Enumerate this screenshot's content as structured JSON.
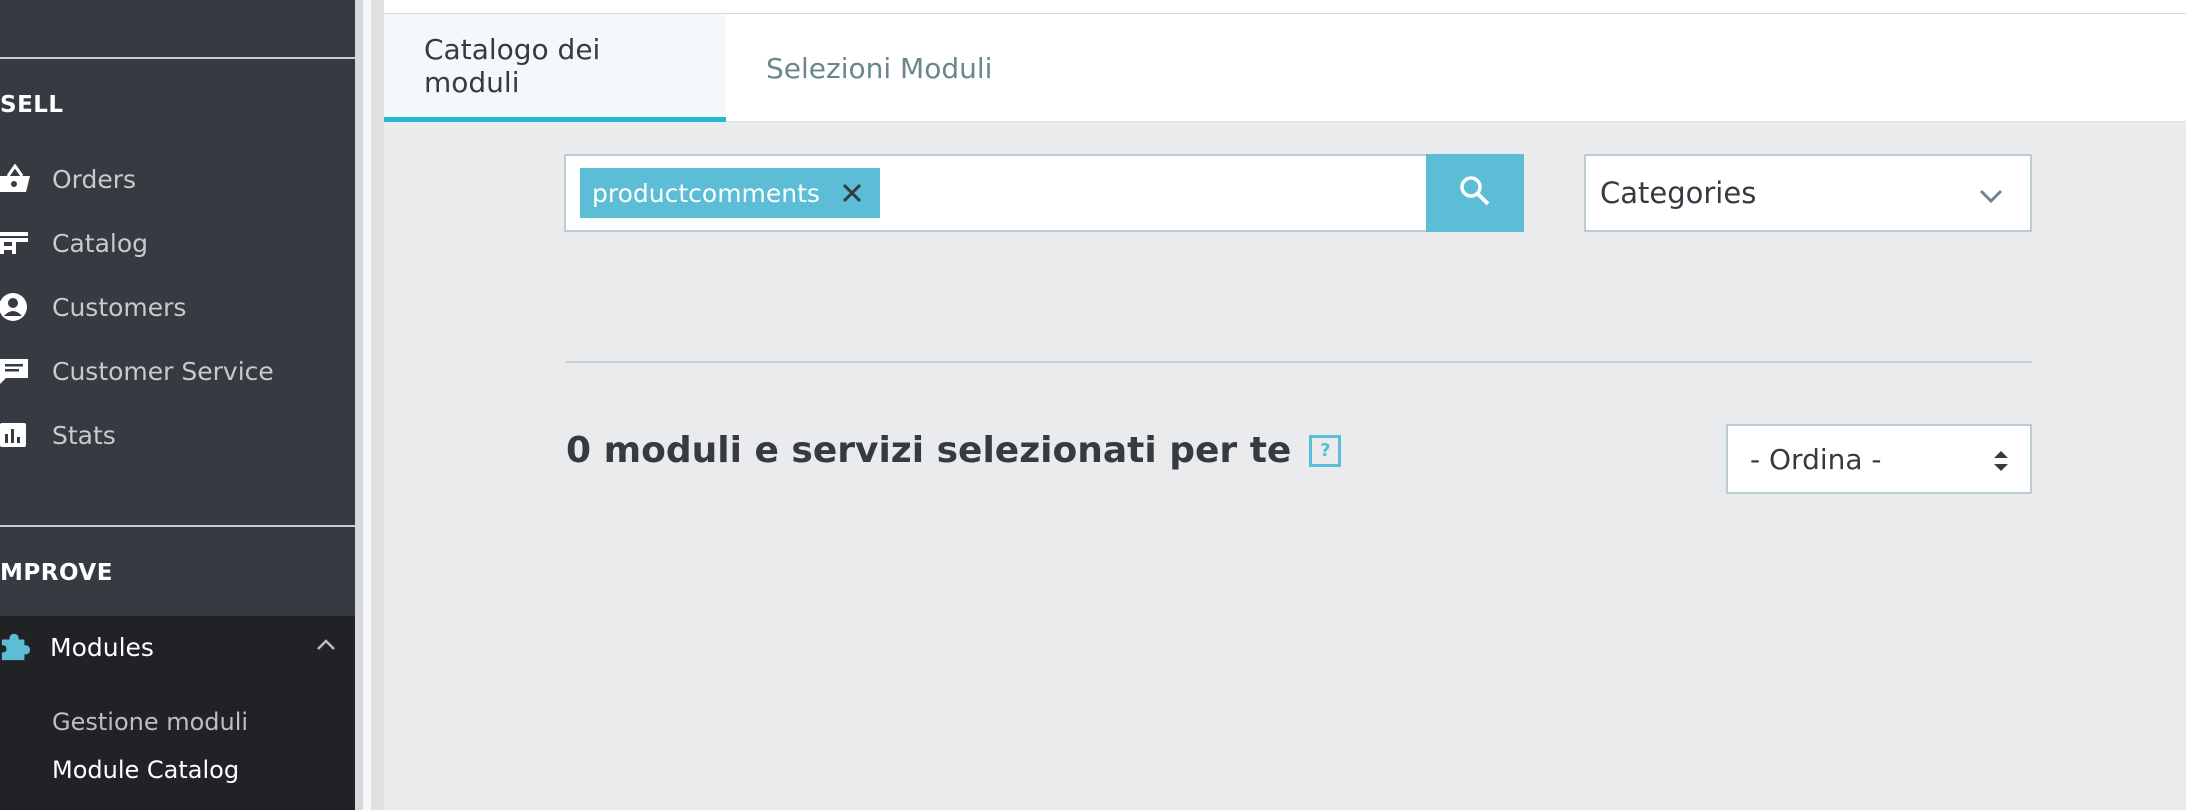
{
  "sidebar": {
    "sections": {
      "sell": "SELL",
      "improve": "MPROVE"
    },
    "items": [
      {
        "label": "Orders",
        "icon": "basket-icon"
      },
      {
        "label": "Catalog",
        "icon": "store-icon"
      },
      {
        "label": "Customers",
        "icon": "user-circle-icon"
      },
      {
        "label": "Customer Service",
        "icon": "chat-icon"
      },
      {
        "label": "Stats",
        "icon": "bar-chart-icon"
      }
    ],
    "active": {
      "label": "Modules",
      "icon": "puzzle-icon"
    },
    "subitems": [
      {
        "label": "Gestione moduli"
      },
      {
        "label": "Module Catalog"
      }
    ]
  },
  "tabs": [
    {
      "label": "Catalogo dei moduli",
      "active": true
    },
    {
      "label": "Selezioni Moduli",
      "active": false
    }
  ],
  "search": {
    "tag": "productcomments"
  },
  "filters": {
    "categories_label": "Categories",
    "sort_label": "- Ordina -"
  },
  "results": {
    "title": "0 moduli e servizi selezionati per te",
    "help_glyph": "?"
  },
  "colors": {
    "accent": "#25b9d7",
    "tag": "#5bbdd6",
    "sidebar": "#363a41"
  }
}
